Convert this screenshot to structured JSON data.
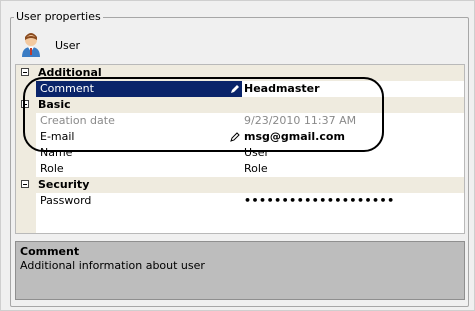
{
  "groupbox": {
    "title": "User properties"
  },
  "user": {
    "name": "User",
    "avatar_icon": "user-avatar-icon"
  },
  "property_grid": {
    "categories": {
      "additional": "Additional",
      "basic": "Basic",
      "security": "Security"
    },
    "rows": {
      "comment": {
        "label": "Comment",
        "value": "Headmaster"
      },
      "creation_date": {
        "label": "Creation date",
        "value": "9/23/2010 11:37 AM"
      },
      "email": {
        "label": "E-mail",
        "value": "msg@gmail.com"
      },
      "name": {
        "label": "Name",
        "value": "User"
      },
      "role": {
        "label": "Role",
        "value": "Role"
      },
      "password": {
        "label": "Password",
        "value": "••••••••••••••••••••"
      }
    }
  },
  "description": {
    "title": "Comment",
    "text": "Additional information about user"
  },
  "colors": {
    "selection": "#0a246a",
    "category_bg": "#efebdf",
    "description_bg": "#bdbdbd"
  }
}
